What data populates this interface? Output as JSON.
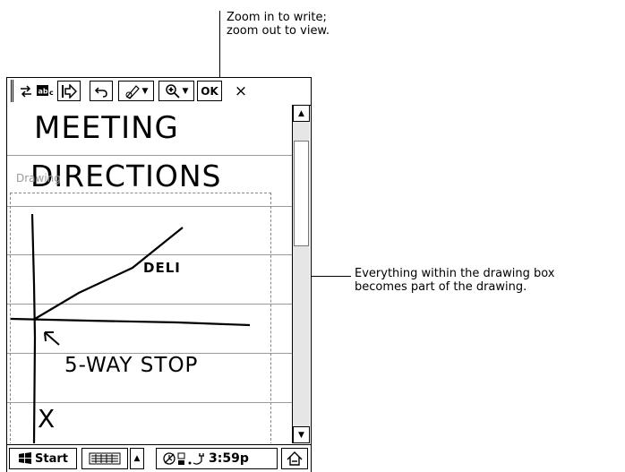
{
  "callouts": {
    "zoom_line1": "Zoom in to write;",
    "zoom_line2": "zoom out to view.",
    "box_line1": "Everything within the drawing box",
    "box_line2": "becomes part of the drawing."
  },
  "toolbar": {
    "ok_label": "OK",
    "close_label": "×",
    "icons": [
      "grip",
      "swap-icon",
      "recognize-icon",
      "insert-icon",
      "undo-icon",
      "pen-icon",
      "zoom-icon"
    ]
  },
  "note": {
    "drawing_label": "Drawing",
    "handwriting": {
      "line1": "MEETING",
      "line2": "DIRECTIONS",
      "deli": "DELI",
      "stop": "5-WAY STOP",
      "x": "X"
    }
  },
  "taskbar": {
    "start_label": "Start",
    "time": "3:59p"
  }
}
